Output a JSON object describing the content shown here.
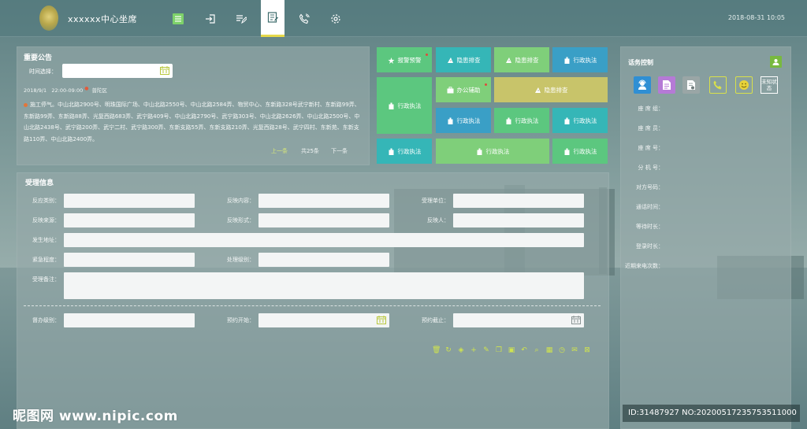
{
  "header": {
    "title": "xxxxxx中心坐席",
    "datetime": "2018-08-31 10:05",
    "nav": [
      {
        "icon": "list-icon"
      },
      {
        "icon": "login-icon"
      },
      {
        "icon": "edit-list-icon"
      },
      {
        "icon": "notes-icon"
      },
      {
        "icon": "phone-icon"
      },
      {
        "icon": "gear-icon"
      }
    ]
  },
  "notice": {
    "title": "重要公告",
    "date_label": "时间选择：",
    "meta_date": "2018/9/1",
    "meta_time": "22:00-09:00",
    "meta_area": "普陀区",
    "body": "施工停气。中山北路2900号、明珠国际广场、中山北路2550号、中山北路2584弄、物贸中心、东新路328号武宁新村、东新路99弄、东新路99弄、东新路88弄、光复西路683弄、武宁路409号、中山北路2790号、武宁路303号、中山北路2626弄、中山北路2500号、中山北路2438号、武宁路200弄、武宁二村、武宁路300弄、东新支路55弄、东新支路210弄、光复西路28号、武宁四村、东新苑、东新支路110弄、中山北路2400弄。",
    "pager": {
      "prev": "上一条",
      "total": "共25条",
      "next": "下一条"
    }
  },
  "tiles": [
    {
      "label": "报警预警",
      "icon": "alarm-icon",
      "color": "#5cc77f",
      "dot": true
    },
    {
      "label": "隐患排查",
      "icon": "inspect-icon",
      "color": "#35b6b7",
      "dot": false
    },
    {
      "label": "隐患排查",
      "icon": "inspect-icon",
      "color": "#7fcf7a",
      "dot": false
    },
    {
      "label": "行政执法",
      "icon": "law-icon",
      "color": "#3a9fc6",
      "dot": false
    },
    {
      "label": "行政执法",
      "icon": "law-icon",
      "color": "#5cc77f",
      "dot": false
    },
    {
      "label": "办公辅助",
      "icon": "briefcase-icon",
      "color": "#7fcf7a",
      "dot": true
    },
    {
      "label": "隐患排查",
      "icon": "inspect-icon",
      "color": "#c8c46a",
      "dot": false
    },
    {
      "label": "行政执法",
      "icon": "law-icon",
      "color": "#3a9fc6",
      "dot": false
    },
    {
      "label": "行政执法",
      "icon": "law-icon",
      "color": "#5cc77f",
      "dot": false
    },
    {
      "label": "行政执法",
      "icon": "law-icon",
      "color": "#35b6b7",
      "dot": false
    },
    {
      "label": "行政执法",
      "icon": "law-icon",
      "color": "#35b6b7",
      "dot": false
    },
    {
      "label": "行政执法",
      "icon": "law-icon",
      "color": "#7fcf7a",
      "dot": false
    },
    {
      "label": "行政执法",
      "icon": "law-icon",
      "color": "#5cc77f",
      "dot": false
    }
  ],
  "acceptance": {
    "title": "受理信息",
    "fields": {
      "reaction_type": "反应类别：",
      "reaction_content": "反映内容：",
      "accept_unit": "受理单位：",
      "reaction_source": "反映来源：",
      "reaction_form": "反映形式：",
      "reporter": "反映人：",
      "address": "发生地址：",
      "urgency": "紧急程度：",
      "handling_level": "处理级别：",
      "remarks": "受理备注：",
      "supervise_level": "督办级别：",
      "appt_start": "预约开始：",
      "appt_end": "预约截止："
    },
    "toolbar": [
      "trash-icon",
      "refresh-icon",
      "layers-icon",
      "plus-icon",
      "pencil-icon",
      "copy-icon",
      "save-icon",
      "undo-icon",
      "search-icon",
      "calendar-icon",
      "clock-icon",
      "mail-icon",
      "delete-icon"
    ]
  },
  "call_control": {
    "title": "话务控制",
    "icons": [
      {
        "name": "agent-icon",
        "color": "#2f8fd4"
      },
      {
        "name": "document-icon",
        "color": "#b57ad6"
      },
      {
        "name": "form-icon",
        "color": "#9aa6a6"
      },
      {
        "name": "phone-icon",
        "color": "#d9e14a"
      },
      {
        "name": "smile-icon",
        "color": "#e8d33a"
      }
    ],
    "status": "未知状态",
    "labels": [
      "座 席 组：",
      "座 席 员：",
      "座 席 号：",
      "分 机 号：",
      "对方号码：",
      "通话时间：",
      "等待时长：",
      "登录时长：",
      "近期来电次数："
    ]
  },
  "watermark": {
    "text": "昵图网 www.nipic.com",
    "id": "ID:31487927 NO:20200517235753511000"
  }
}
